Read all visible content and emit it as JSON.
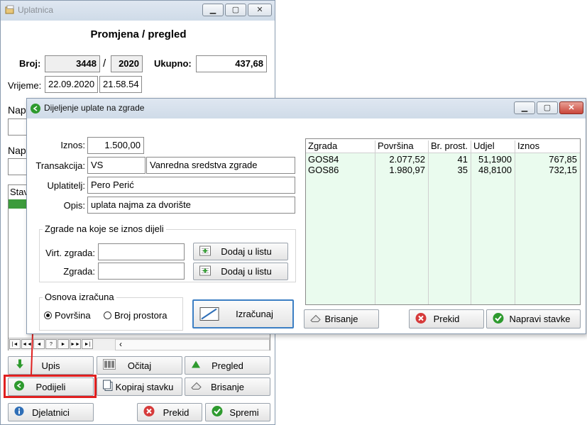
{
  "main_window": {
    "title": "Uplatnica",
    "heading": "Promjena / pregled",
    "broj_label": "Broj:",
    "broj_value": "3448",
    "separator": "/",
    "year_value": "2020",
    "ukupno_label": "Ukupno:",
    "ukupno_value": "437,68",
    "vrijeme_label": "Vrijeme:",
    "date_value": "22.09.2020",
    "time_value": "21.58.54",
    "nap1_label": "Nap",
    "nap2_label": "Nap",
    "stav_label": "Stav",
    "nav_buttons": [
      "|◄",
      "◄◄",
      "◄",
      "?",
      "►",
      "►►",
      "►|"
    ],
    "scroll_left": "‹",
    "buttons": {
      "upis": "Upis",
      "ocitaj": "Očitaj",
      "pregled": "Pregled",
      "podijeli": "Podijeli",
      "kopiraj": "Kopiraj stavku",
      "brisanje": "Brisanje",
      "djelatnici": "Djelatnici",
      "prekid": "Prekid",
      "spremi": "Spremi"
    }
  },
  "dialog": {
    "title": "Dijeljenje uplate na zgrade",
    "iznos_label": "Iznos:",
    "iznos_value": "1.500,00",
    "transakcija_label": "Transakcija:",
    "transakcija_code": "VS",
    "transakcija_desc": "Vanredna sredstva zgrade",
    "uplatitelj_label": "Uplatitelj:",
    "uplatitelj_value": "Pero Perić",
    "opis_label": "Opis:",
    "opis_value": "uplata najma za dvorište",
    "zgrade_group_title": "Zgrade na koje se iznos dijeli",
    "virt_zgrada_label": "Virt. zgrada:",
    "zgrada_label": "Zgrada:",
    "dodaj_label_1": "Dodaj u listu",
    "dodaj_label_2": "Dodaj u listu",
    "osnova_group_title": "Osnova izračuna",
    "radio_povrsina": "Površina",
    "radio_broj": "Broj prostora",
    "izracunaj": "Izračunaj",
    "table": {
      "headers": [
        "Zgrada",
        "Površina",
        "Br. prost.",
        "Udjel",
        "Iznos"
      ],
      "rows": [
        [
          "GOS84",
          "2.077,52",
          "41",
          "51,1900",
          "767,85"
        ],
        [
          "GOS86",
          "1.980,97",
          "35",
          "48,8100",
          "732,15"
        ]
      ]
    },
    "brisanje": "Brisanje",
    "prekid": "Prekid",
    "napravi": "Napravi stavke"
  },
  "colors": {
    "grid_bg": "#eafbee",
    "highlight_red": "#e02020",
    "green_row": "#3c9b3c",
    "accent_blue": "#2f6fb7"
  }
}
